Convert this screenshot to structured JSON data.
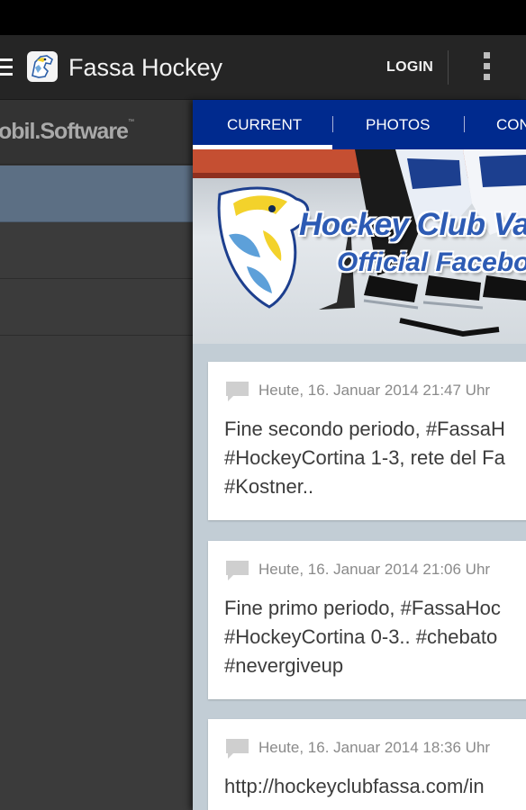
{
  "app": {
    "title": "Fassa Hockey",
    "login_label": "LOGIN",
    "icons": {
      "menu": "hamburger-icon",
      "logo": "eagle-logo-icon",
      "overflow": "overflow-menu-icon"
    }
  },
  "drawer": {
    "brand": "obil.Software",
    "brand_mark": "™",
    "items": [
      {
        "active": true
      },
      {
        "active": false
      },
      {
        "active": false
      }
    ]
  },
  "tabs": [
    {
      "label": "CURRENT",
      "selected": true
    },
    {
      "label": "PHOTOS",
      "selected": false
    },
    {
      "label": "CON",
      "selected": false
    }
  ],
  "banner": {
    "line1": "Hockey Club Va",
    "line2": "Official Facebo"
  },
  "posts": [
    {
      "date": "Heute, 16. Januar 2014 21:47 Uhr",
      "lines": [
        "Fine secondo periodo, #FassaH",
        "#HockeyCortina 1-3, rete del Fa",
        "#Kostner.."
      ]
    },
    {
      "date": "Heute, 16. Januar 2014 21:06 Uhr",
      "lines": [
        "Fine primo periodo, #FassaHoc",
        "#HockeyCortina 0-3.. #chebato",
        "#nevergiveup"
      ]
    },
    {
      "date": "Heute, 16. Januar 2014 18:36 Uhr",
      "lines": [
        "http://hockeyclubfassa.com/in"
      ]
    }
  ],
  "colors": {
    "actionbar": "#252525",
    "tabbar": "#002a8e",
    "drawer": "#3b3b3b",
    "drawer_active": "#5c6f84",
    "feed_background": "#c2cdd5"
  }
}
